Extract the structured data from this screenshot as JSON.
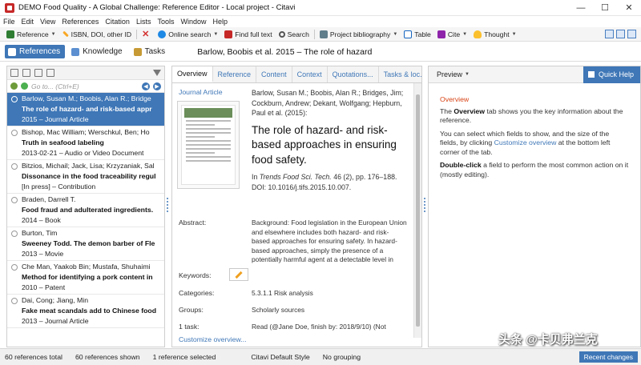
{
  "window": {
    "title": "DEMO Food Quality - A Global Challenge: Reference Editor - Local project - Citavi",
    "controls": [
      "—",
      "☐",
      "✕"
    ]
  },
  "menu": [
    "File",
    "Edit",
    "View",
    "References",
    "Citation",
    "Lists",
    "Tools",
    "Window",
    "Help"
  ],
  "toolbar": {
    "reference": "Reference",
    "isbn": "ISBN, DOI, other ID",
    "online_search": "Online search",
    "find_full_text": "Find full text",
    "search": "Search",
    "project_bibliography": "Project bibliography",
    "table": "Table",
    "cite": "Cite",
    "thought": "Thought"
  },
  "nav": {
    "tabs": [
      "References",
      "Knowledge",
      "Tasks"
    ],
    "reference_heading": "Barlow, Boobis et al. 2015 – The role of hazard"
  },
  "left": {
    "goto_placeholder": "Go to... (Ctrl+E)",
    "references": [
      {
        "authors": "Barlow, Susan M.; Boobis, Alan R.; Bridge",
        "title": "The role of hazard- and risk-based appr",
        "meta": "2015 – Journal Article"
      },
      {
        "authors": "Bishop, Mac William; Werschkul, Ben; Ho",
        "title": "Truth in seafood labeling",
        "meta": "2013-02-21 – Audio or Video Document"
      },
      {
        "authors": "Bitzios, Michail; Jack, Lisa; Krzyzaniak, Sal",
        "title": "Dissonance in the food traceability regul",
        "meta": "[In press] – Contribution"
      },
      {
        "authors": "Braden, Darrell T.",
        "title": "Food fraud and adulterated ingredients.",
        "meta": "2014 – Book"
      },
      {
        "authors": "Burton, Tim",
        "title": "Sweeney Todd. The demon barber of Fle",
        "meta": "2013 – Movie"
      },
      {
        "authors": "Che Man, Yaakob Bin; Mustafa, Shuhaimi",
        "title": "Method for identifying a pork content in",
        "meta": "2010 – Patent"
      },
      {
        "authors": "Dai, Cong; Jiang, Min",
        "title": "Fake meat scandals add to Chinese food",
        "meta": "2013 – Journal Article"
      }
    ]
  },
  "center": {
    "tabs": [
      "Overview",
      "Reference",
      "Content",
      "Context",
      "Quotations...",
      "Tasks & loc..."
    ],
    "reference_type": "Journal Article",
    "authors": "Barlow, Susan M.; Boobis, Alan R.; Bridges, Jim; Cockburn, Andrew; Dekant, Wolfgang; Hepburn, Paul et al. (2015):",
    "title": "The role of hazard- and risk-based approaches in ensuring food safety.",
    "source_prefix": "In ",
    "journal": "Trends Food Sci. Tech.",
    "source_suffix": " 46 (2), pp. 176–188. DOI: 10.1016/j.tifs.2015.10.007.",
    "abstract_label": "Abstract:",
    "abstract": "Background: Food legislation in the European Union and elsewhere includes both hazard- and risk-based approaches for ensuring safety. In hazard-based approaches, simply the presence of a potentially harmful agent at a detectable level in food is used (...)",
    "keywords_label": "Keywords:",
    "categories_label": "Categories:",
    "categories": "5.3.1.1 Risk analysis",
    "groups_label": "Groups:",
    "groups": "Scholarly sources",
    "task_label": "1 task:",
    "task": "Read (@Jane Doe, finish by: 2018/9/10) (Not",
    "customize": "Customize overview..."
  },
  "right": {
    "preview": "Preview",
    "quick_help": "Quick Help",
    "help_heading": "Overview",
    "help_p1_a": "The ",
    "help_p1_b": "Overview",
    "help_p1_c": " tab shows you the key information about the reference.",
    "help_p2_a": "You can select which fields to show, and the size of the fields, by clicking ",
    "help_p2_link": "Customize overview",
    "help_p2_c": " at the bottom left corner of the tab.",
    "help_p3_a": "Double-click",
    "help_p3_b": " a field to perform the most common action on it (mostly editing)."
  },
  "status": {
    "total": "60 references total",
    "shown": "60 references shown",
    "selected": "1 reference selected",
    "style": "Citavi Default Style",
    "grouping": "No grouping",
    "recent": "Recent changes"
  },
  "watermark": "头条 @卡贝弗兰克",
  "colors": {
    "accent": "#3f77b7",
    "help_heading": "#d84315"
  }
}
